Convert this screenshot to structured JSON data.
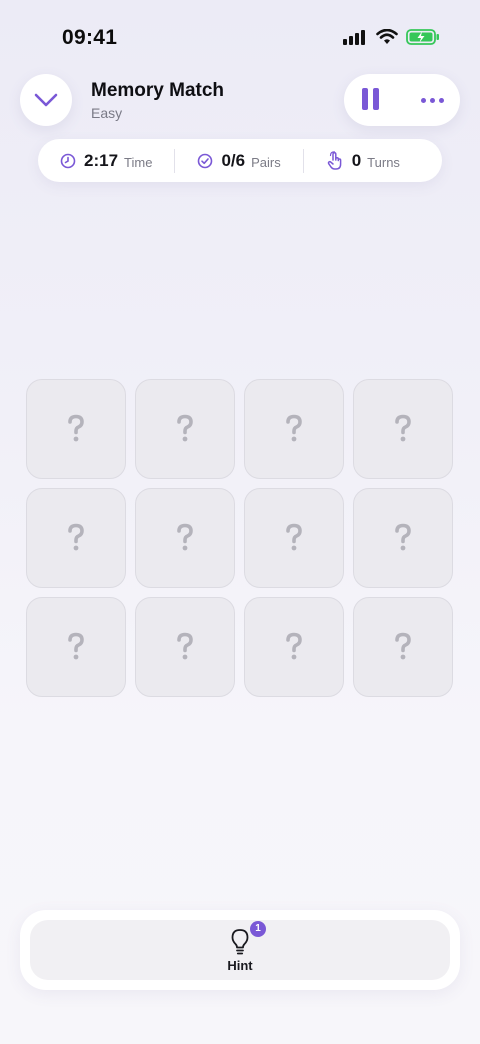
{
  "status_bar": {
    "time": "09:41",
    "icons": [
      "signal-icon",
      "wifi-icon",
      "battery-charging-icon"
    ],
    "battery_color": "#35c759"
  },
  "header": {
    "back_icon": "chevron-down-icon",
    "title": "Memory Match",
    "difficulty": "Easy",
    "pause_icon": "pause-icon",
    "more_icon": "more-horizontal-icon"
  },
  "stats": {
    "time": {
      "icon": "clock-icon",
      "value": "2:17",
      "label": "Time"
    },
    "pairs": {
      "icon": "check-circle-icon",
      "value": "0/6",
      "label": "Pairs"
    },
    "turns": {
      "icon": "tap-hand-icon",
      "value": "0",
      "label": "Turns"
    }
  },
  "board": {
    "rows": 3,
    "cols": 4,
    "cards": [
      {
        "state": "face-down",
        "symbol": "?"
      },
      {
        "state": "face-down",
        "symbol": "?"
      },
      {
        "state": "face-down",
        "symbol": "?"
      },
      {
        "state": "face-down",
        "symbol": "?"
      },
      {
        "state": "face-down",
        "symbol": "?"
      },
      {
        "state": "face-down",
        "symbol": "?"
      },
      {
        "state": "face-down",
        "symbol": "?"
      },
      {
        "state": "face-down",
        "symbol": "?"
      },
      {
        "state": "face-down",
        "symbol": "?"
      },
      {
        "state": "face-down",
        "symbol": "?"
      },
      {
        "state": "face-down",
        "symbol": "?"
      },
      {
        "state": "face-down",
        "symbol": "?"
      }
    ]
  },
  "hint": {
    "icon": "lightbulb-icon",
    "label": "Hint",
    "count": "1"
  },
  "colors": {
    "accent": "#7a58d6",
    "card_bg": "#ebeaef",
    "card_border": "#dcdbe2"
  }
}
